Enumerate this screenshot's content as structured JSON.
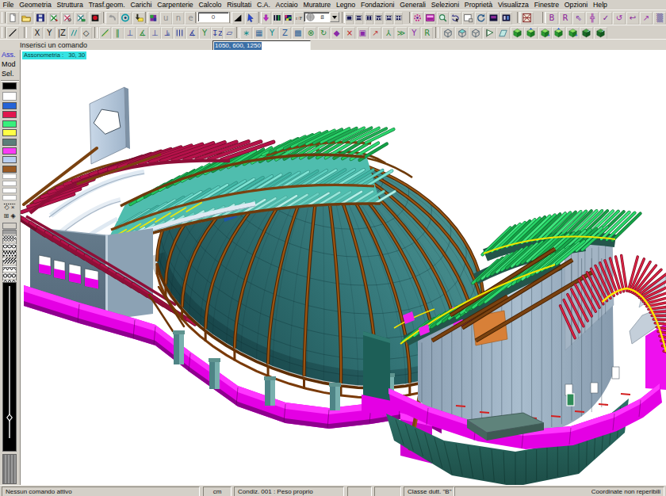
{
  "menu": {
    "items": [
      "File",
      "Geometria",
      "Struttura",
      "Trasf.geom.",
      "Carichi",
      "Carpenterie",
      "Calcolo",
      "Risultati",
      "C.A.",
      "Acciaio",
      "Murature",
      "Legno",
      "Fondazioni",
      "Generali",
      "Selezioni",
      "Proprietà",
      "Visualizza",
      "Finestre",
      "Opzioni",
      "Help"
    ]
  },
  "toolbar1": {
    "groups": [
      {
        "items": [
          {
            "n": "new-file-icon",
            "s": "page"
          },
          {
            "n": "open-file-icon",
            "s": "folder"
          },
          {
            "n": "save-file-icon",
            "s": "floppy"
          },
          {
            "n": "import-dxf-icon",
            "s": "impx1"
          },
          {
            "n": "export-dxf-icon",
            "s": "impx2"
          },
          {
            "n": "merge-model-icon",
            "s": "impx3"
          },
          {
            "n": "render-icon",
            "s": "rnd"
          }
        ]
      },
      {
        "items": [
          {
            "n": "undo-icon",
            "s": "undo"
          },
          {
            "n": "visibility-icon",
            "s": "eye"
          },
          {
            "n": "paste-command-icon",
            "s": "paste"
          }
        ]
      },
      {
        "items": [
          {
            "n": "layer-palette-icon",
            "s": "palette"
          },
          {
            "n": "union-icon",
            "g": "u",
            "c": "#8a8a8a"
          },
          {
            "n": "intersection-icon",
            "g": "n",
            "c": "#8a8a8a"
          },
          {
            "n": "element-icon",
            "g": "e",
            "c": "#8a8a8a"
          }
        ]
      },
      {
        "items": [
          {
            "n": "shade-mode-icon",
            "s": "tri"
          },
          {
            "n": "select-arrow-icon",
            "s": "cursor"
          }
        ]
      },
      {
        "items": [
          {
            "n": "drop-node-icon",
            "s": "darr"
          },
          {
            "n": "table-nodes-icon",
            "s": "tbl1"
          },
          {
            "n": "table-colors-icon",
            "s": "tbl2"
          },
          {
            "n": "local-axes-icon",
            "s": "rf"
          }
        ]
      },
      {
        "items": [
          {
            "n": "cascade-icon",
            "s": "win1"
          },
          {
            "n": "tile-horizontal-icon",
            "s": "win2"
          },
          {
            "n": "tile-vertical-icon",
            "s": "win3"
          },
          {
            "n": "split-three-icon",
            "s": "win4"
          },
          {
            "n": "split-grid-icon",
            "s": "win5"
          },
          {
            "n": "split-quad-icon",
            "s": "win6"
          }
        ]
      },
      {
        "items": [
          {
            "n": "snap-settings-icon",
            "s": "gear"
          },
          {
            "n": "view-window-icon",
            "s": "magwin"
          },
          {
            "n": "zoom-window-icon",
            "s": "lens"
          },
          {
            "n": "rotate-view-icon",
            "s": "rotview"
          },
          {
            "n": "new-window-icon",
            "s": "newwin"
          },
          {
            "n": "redraw-icon",
            "s": "refresh"
          },
          {
            "n": "screen-a-icon",
            "s": "scr1"
          },
          {
            "n": "screen-b-icon",
            "s": "scr2"
          }
        ]
      },
      {
        "items": [
          {
            "n": "column-check-icon",
            "s": "column"
          }
        ]
      },
      {
        "items": [
          {
            "n": "beam-tool-icon",
            "g": "B",
            "c": "#8a1a9a"
          },
          {
            "n": "rod-tool-icon",
            "g": "R",
            "c": "#8a1a9a"
          },
          {
            "n": "pick-tool-icon",
            "g": "⇖",
            "c": "#7a2aa8"
          },
          {
            "n": "node-move-icon",
            "g": "╬",
            "c": "#9a2aa8"
          },
          {
            "n": "check-model-icon",
            "g": "✓",
            "c": "#7a1a9a"
          },
          {
            "n": "rotate-ccw-icon",
            "g": "↺",
            "c": "#9a2aa8"
          },
          {
            "n": "undo-view-icon",
            "g": "↩",
            "c": "#8a2a9a"
          },
          {
            "n": "measure-icon",
            "g": "↗",
            "c": "#9a2aa8"
          },
          {
            "n": "monitor-icon",
            "g": "▒",
            "c": "#5a4a9a"
          }
        ]
      }
    ],
    "angle_value": "0",
    "size_value": "8"
  },
  "toolbar2": {
    "groups": [
      {
        "items": [
          {
            "n": "draw-line-icon",
            "s": "dline"
          }
        ]
      },
      {
        "items": [
          {
            "n": "snap-x-icon",
            "g": "X",
            "c": "#1a1a1a"
          },
          {
            "n": "snap-y-icon",
            "g": "Y",
            "c": "#1a1a1a"
          },
          {
            "n": "snap-z-icon",
            "g": "|Z",
            "c": "#1a1a1a"
          },
          {
            "n": "snap-parallel-icon",
            "s": "par"
          },
          {
            "n": "snap-polygon-icon",
            "g": "◇",
            "c": "#1a1a1a"
          }
        ]
      },
      {
        "items": [
          {
            "n": "ref-line-icon",
            "s": "dline2"
          },
          {
            "n": "ref-parallel-icon",
            "g": "‖",
            "c": "#2a8a3a"
          },
          {
            "n": "ref-perp-icon",
            "g": "⊥",
            "c": "#2a3a9a"
          },
          {
            "n": "ref-angle-icon",
            "g": "∡",
            "c": "#2a8a3a"
          },
          {
            "n": "ref-perp2-icon",
            "g": "⊥",
            "c": "#2a3a9a"
          },
          {
            "n": "ref-mid-icon",
            "g": "⫡",
            "c": "#2a3a9a"
          },
          {
            "n": "ref-triple-icon",
            "s": "tri3"
          },
          {
            "n": "ref-angle2-icon",
            "g": "∡",
            "c": "#2a3a9a"
          },
          {
            "n": "ref-wye-icon",
            "g": "Y",
            "c": "#2a8a3a"
          },
          {
            "n": "ref-z-icon",
            "g": "↧z",
            "c": "#2a3a9a"
          },
          {
            "n": "ref-box-icon",
            "g": "▱",
            "c": "#2a3a9a"
          }
        ]
      },
      {
        "items": [
          {
            "n": "add-node-icon",
            "g": "∗",
            "c": "#0a8a8a"
          },
          {
            "n": "mesh-icon",
            "g": "▦",
            "c": "#3a6a9a"
          },
          {
            "n": "mesh-y-icon",
            "g": "Y",
            "c": "#0a8a8a"
          },
          {
            "n": "mesh-z-icon",
            "g": "Z",
            "c": "#2a5a9a"
          },
          {
            "n": "grid-icon",
            "g": "▩",
            "c": "#3a6a9a"
          },
          {
            "n": "split-element-icon",
            "g": "⊗",
            "c": "#2a8a3a"
          },
          {
            "n": "rotate-element-icon",
            "g": "↻",
            "c": "#2a8a3a"
          },
          {
            "n": "solid-element-icon",
            "g": "◆",
            "c": "#8a2aa8"
          },
          {
            "n": "delete-element-icon",
            "g": "×",
            "c": "#c02020"
          },
          {
            "n": "box-node-icon",
            "g": "▣",
            "c": "#8a2aa8"
          },
          {
            "n": "stretch-icon",
            "g": "↗",
            "c": "#c03030"
          },
          {
            "n": "extrude-icon",
            "g": "⅄",
            "c": "#2a8a3a"
          },
          {
            "n": "move-icon",
            "g": "≫",
            "c": "#2a8a3a"
          },
          {
            "n": "mirror-icon",
            "g": "Y",
            "c": "#8a2aa8"
          },
          {
            "n": "replicate-icon",
            "g": "R",
            "c": "#2a8a3a"
          }
        ]
      },
      {
        "items": [
          {
            "n": "wire-view-icon",
            "s": "wcube"
          },
          {
            "n": "hidden-view-icon",
            "s": "wcube2"
          },
          {
            "n": "outline-view-icon",
            "s": "wcube"
          },
          {
            "n": "fast-view-icon",
            "s": "flag"
          },
          {
            "n": "plane-view-icon",
            "s": "plane"
          },
          {
            "n": "solid-view-icon",
            "s": "gcube"
          },
          {
            "n": "solid-arrows-icon",
            "s": "gcube2"
          },
          {
            "n": "solid-drop-icon",
            "s": "gcube3"
          },
          {
            "n": "solid-zoom-icon",
            "s": "gcube2"
          },
          {
            "n": "solid-axes-icon",
            "s": "gcube3"
          },
          {
            "n": "solid-dark-icon",
            "s": "dcube"
          },
          {
            "n": "solid-dark2-icon",
            "s": "dcube"
          }
        ]
      }
    ]
  },
  "commandbar": {
    "label": "Inserisci un comando",
    "value": "1050, 600, 1250"
  },
  "viewport": {
    "view_label": "Assonometria :   30, 30"
  },
  "sidepanel": {
    "tabs": [
      {
        "label": "Ass.",
        "active": true
      },
      {
        "label": "Mod",
        "active": false
      },
      {
        "label": "Sel.",
        "active": false
      }
    ],
    "current_color": "#000000",
    "colors": [
      "#2563d6",
      "#e0164e",
      "#37ef7c",
      "#ffff45",
      "#5c7f7a",
      "#f93bf5",
      "#b8cef0",
      "#9a5a22"
    ],
    "line_styles": [
      "solid",
      "dash-long",
      "dash-short",
      "dots"
    ],
    "markers": [
      "◇",
      "×",
      "⊞",
      "◈"
    ],
    "patterns": [
      "solid-gray",
      "crosshatch",
      "ovals",
      "dots-dense",
      "diagonal",
      "zigzag",
      "rings",
      "diamonds"
    ]
  },
  "statusbar": {
    "segments": [
      {
        "text": "Nessun comando attivo",
        "align": "left"
      },
      {
        "text": "cm",
        "align": "center"
      },
      {
        "text": "Condiz. 001 : Peso proprio",
        "align": "left"
      },
      {
        "text": "",
        "align": "left"
      },
      {
        "text": "",
        "align": "left"
      },
      {
        "text": "Classe dutt. \"B\"",
        "align": "left"
      },
      {
        "text": "Coordinate non reperibili",
        "align": "right"
      }
    ]
  },
  "model_colors": {
    "dome_dark": "#16424a",
    "dome_mid": "#2a6a6b",
    "dome_light": "#4e9a98",
    "rib_brown": "#7a3a08",
    "slat_green": "#23c55e",
    "slat_maroon": "#a8123f",
    "magenta": "#ee00ee",
    "wall_gray": "#5d7383",
    "cylinder_gray": "#9fb4c6",
    "plinth_teal": "#2e6f68",
    "accent_yellow": "#f0e400",
    "patch_blue": "#2b6bc0"
  }
}
